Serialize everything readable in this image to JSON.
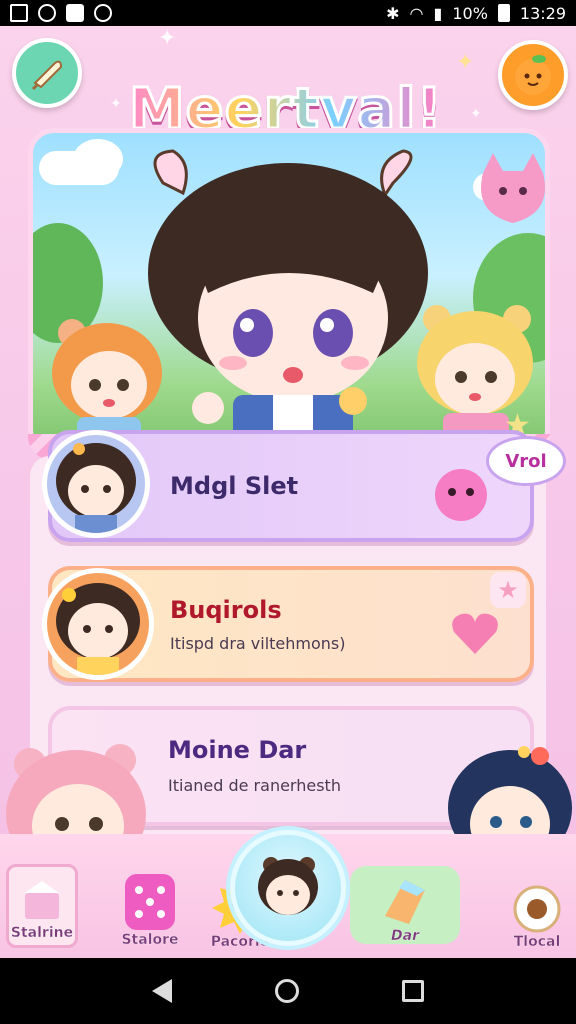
{
  "status_bar": {
    "battery_text": "10%",
    "time": "13:29"
  },
  "header": {
    "title": "Meertval!",
    "menu_icon": "scroll-quill-icon",
    "right_icon": "orange-fruit-icon"
  },
  "cards": [
    {
      "title": "Mdgl Slet",
      "subtitle": "",
      "bubble_text": "Vrol",
      "title_color": "#3c2a6b"
    },
    {
      "title": "Buqirols",
      "subtitle": "Itispd dra viltehmons)",
      "title_color": "#b0182b"
    },
    {
      "title": "Moine Dar",
      "subtitle": "Itianed de ranerhesth",
      "title_color": "#4b2a80"
    }
  ],
  "bottom_nav": {
    "items": [
      {
        "label": "Stalrine",
        "icon": "gift-box-icon"
      },
      {
        "label": "Stalore",
        "icon": "dice-icon"
      },
      {
        "label": "Pacorie",
        "icon": "sun-character-icon"
      },
      {
        "label": "",
        "icon": "avatar-center-icon"
      },
      {
        "label": "Dar",
        "icon": "crystal-icon"
      },
      {
        "label": "Tlocal",
        "icon": "camera-icon"
      }
    ]
  },
  "colors": {
    "accent_pink": "#f7c9e6",
    "accent_purple": "#c9a4ee",
    "accent_orange": "#fbb08a"
  }
}
